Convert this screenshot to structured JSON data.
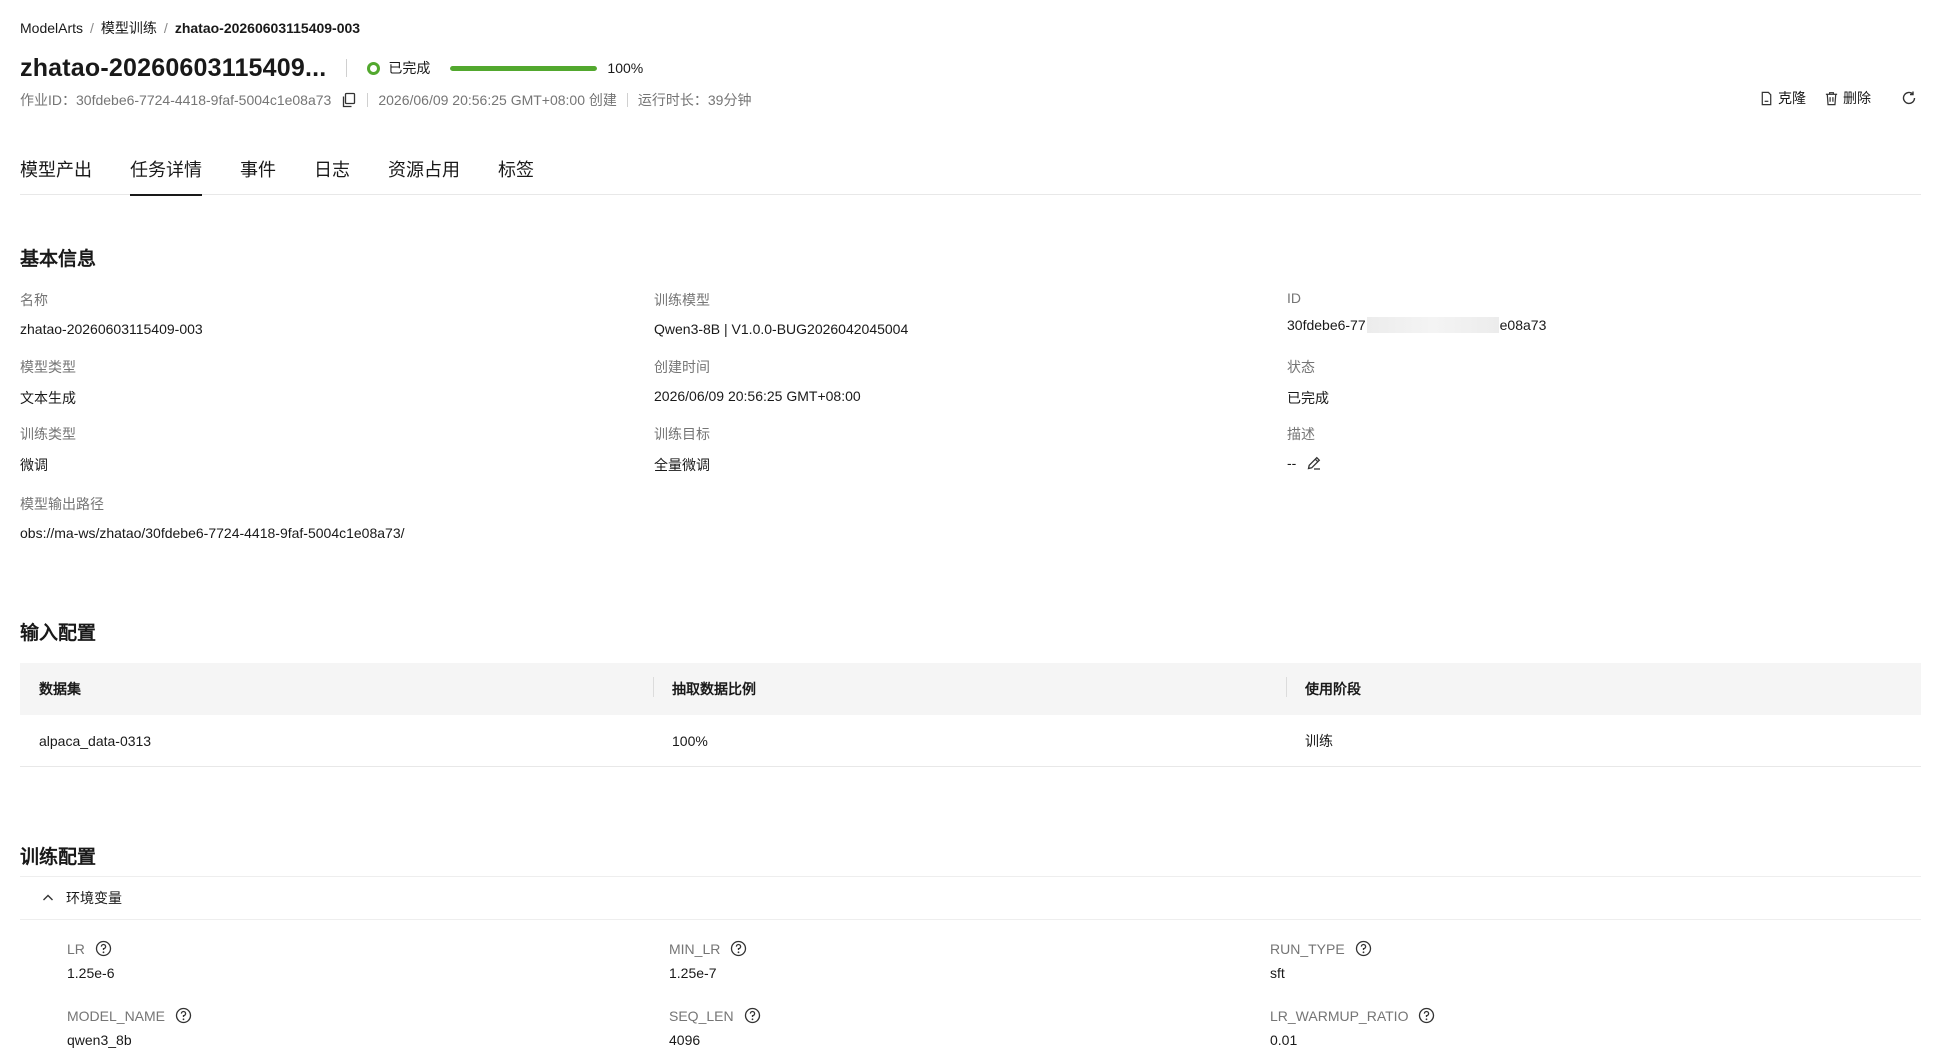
{
  "breadcrumb": {
    "items": [
      "ModelArts",
      "模型训练"
    ],
    "separator": "/",
    "current": "zhatao-20260603115409-003"
  },
  "header": {
    "title": "zhatao-2026060311540​9...",
    "status_label": "已完成",
    "progress_percent": 100,
    "progress_text": "100%",
    "job_id_text": "作业ID：30fdebe6-7724-4418-9faf-5004c1e08a73",
    "created_text": "2026/06/09 20:56:25 GMT+08:00 创建",
    "runtime_text": "运行时长：39分钟",
    "status_color": "#52a82e"
  },
  "actions": {
    "clone_label": "克隆",
    "delete_label": "删除",
    "clone_icon": "clone-icon",
    "delete_icon": "trash-icon",
    "refresh_icon": "refresh-icon"
  },
  "tabs": [
    {
      "label": "模型产出"
    },
    {
      "label": "任务详情",
      "active": true
    },
    {
      "label": "事件"
    },
    {
      "label": "日志"
    },
    {
      "label": "资源占用"
    },
    {
      "label": "标签"
    }
  ],
  "basic_info": {
    "title": "基本信息",
    "name_label": "名称",
    "name_value": "zhatao-20260603115409-003",
    "train_model_label": "训练模型",
    "train_model_value": "Qwen3-8B | V1.0.0-BUG2026042045004",
    "id_label": "ID",
    "id_prefix": "30fdebe6-77",
    "id_suffix": "e08a73",
    "model_type_label": "模型类型",
    "model_type_value": "文本生成",
    "created_label": "创建时间",
    "created_value": "2026/06/09 20:56:25 GMT+08:00",
    "status_label": "状态",
    "status_value": "已完成",
    "train_type_label": "训练类型",
    "train_type_value": "微调",
    "train_goal_label": "训练目标",
    "train_goal_value": "全量微调",
    "desc_label": "描述",
    "desc_value": "--",
    "output_path_label": "模型输出路径",
    "output_path_value": "obs://ma-ws/zhatao/30fdebe6-7724-4418-9faf-5004c1e08a73/"
  },
  "input_config": {
    "title": "输入配置",
    "columns": [
      "数据集",
      "抽取数据比例",
      "使用阶段"
    ],
    "rows": [
      [
        "alpaca_data-0313",
        "100%",
        "训练"
      ]
    ]
  },
  "train_config": {
    "title": "训练配置",
    "env_header": "环境变量",
    "env": [
      {
        "label": "LR",
        "value": "1.25e-6"
      },
      {
        "label": "MIN_LR",
        "value": "1.25e-7"
      },
      {
        "label": "RUN_TYPE",
        "value": "sft"
      },
      {
        "label": "MODEL_NAME",
        "value": "qwen3_8b"
      },
      {
        "label": "SEQ_LEN",
        "value": "4096"
      },
      {
        "label": "LR_WARMUP_RATIO",
        "value": "0.01"
      }
    ]
  }
}
